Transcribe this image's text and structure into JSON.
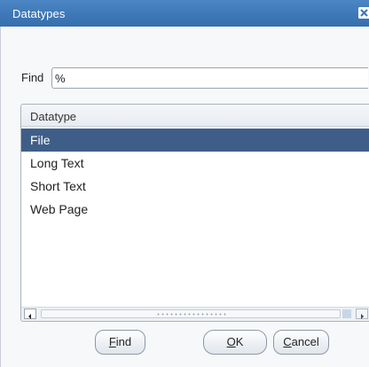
{
  "window": {
    "title": "Datatypes",
    "close_icon": "close-icon"
  },
  "search": {
    "label": "Find",
    "value": "%"
  },
  "list": {
    "column_header": "Datatype",
    "items": [
      {
        "label": "File",
        "selected": true
      },
      {
        "label": "Long Text",
        "selected": false
      },
      {
        "label": "Short Text",
        "selected": false
      },
      {
        "label": "Web Page",
        "selected": false
      }
    ]
  },
  "buttons": {
    "find_first": "F",
    "find_rest": "ind",
    "ok_first": "O",
    "ok_rest": "K",
    "cancel_first": "C",
    "cancel_rest": "ancel"
  },
  "colors": {
    "titlebar": "#3f79b8",
    "selection": "#3f5e87",
    "background": "#f7f8fa"
  }
}
